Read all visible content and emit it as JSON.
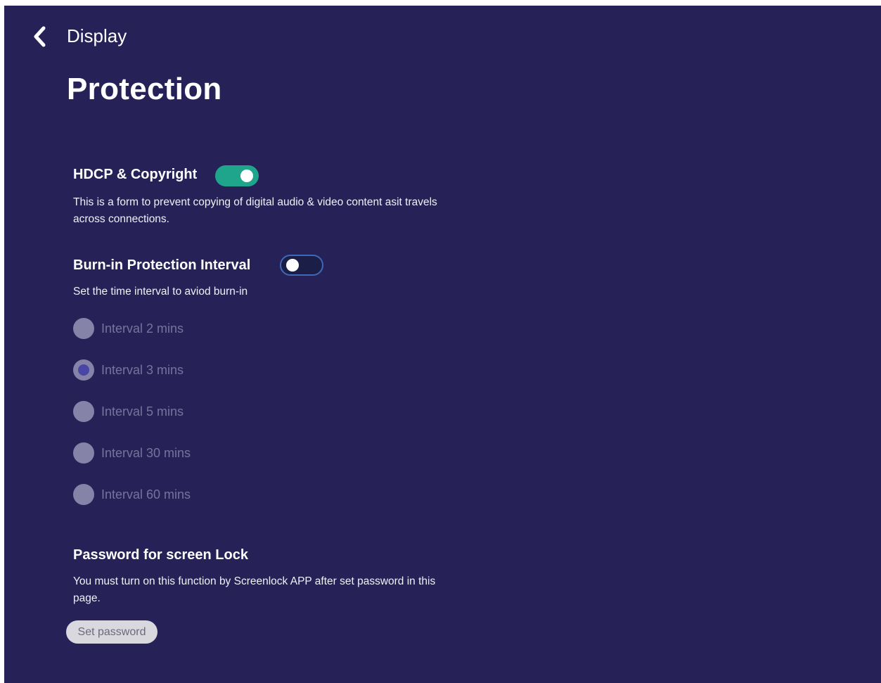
{
  "header": {
    "back_icon": "chevron-left-icon",
    "breadcrumb": "Display",
    "title": "Protection"
  },
  "hdcp": {
    "title": "HDCP & Copyright",
    "enabled": true,
    "description_line1": "This is a form to prevent copying of digital audio & video content asit travels",
    "description_line2": "across connections."
  },
  "burn_in": {
    "title": "Burn-in Protection Interval",
    "enabled": false,
    "description": "Set the time interval to aviod burn-in",
    "options": [
      {
        "label": "Interval 2 mins",
        "selected": false
      },
      {
        "label": "Interval 3 mins",
        "selected": true
      },
      {
        "label": "Interval 5 mins",
        "selected": false
      },
      {
        "label": "Interval 30 mins",
        "selected": false
      },
      {
        "label": "Interval 60 mins",
        "selected": false
      }
    ]
  },
  "screen_lock": {
    "title": "Password for screen Lock",
    "description_line1": "You must turn on this function by Screenlock APP after set password in this",
    "description_line2": "page.",
    "button_label": "Set password"
  },
  "colors": {
    "background": "#262257",
    "toggle_on": "#1fa58c",
    "toggle_off_border": "#3f69b8",
    "radio_disabled": "#8583a8",
    "radio_selected_dot": "#4a46a6"
  }
}
